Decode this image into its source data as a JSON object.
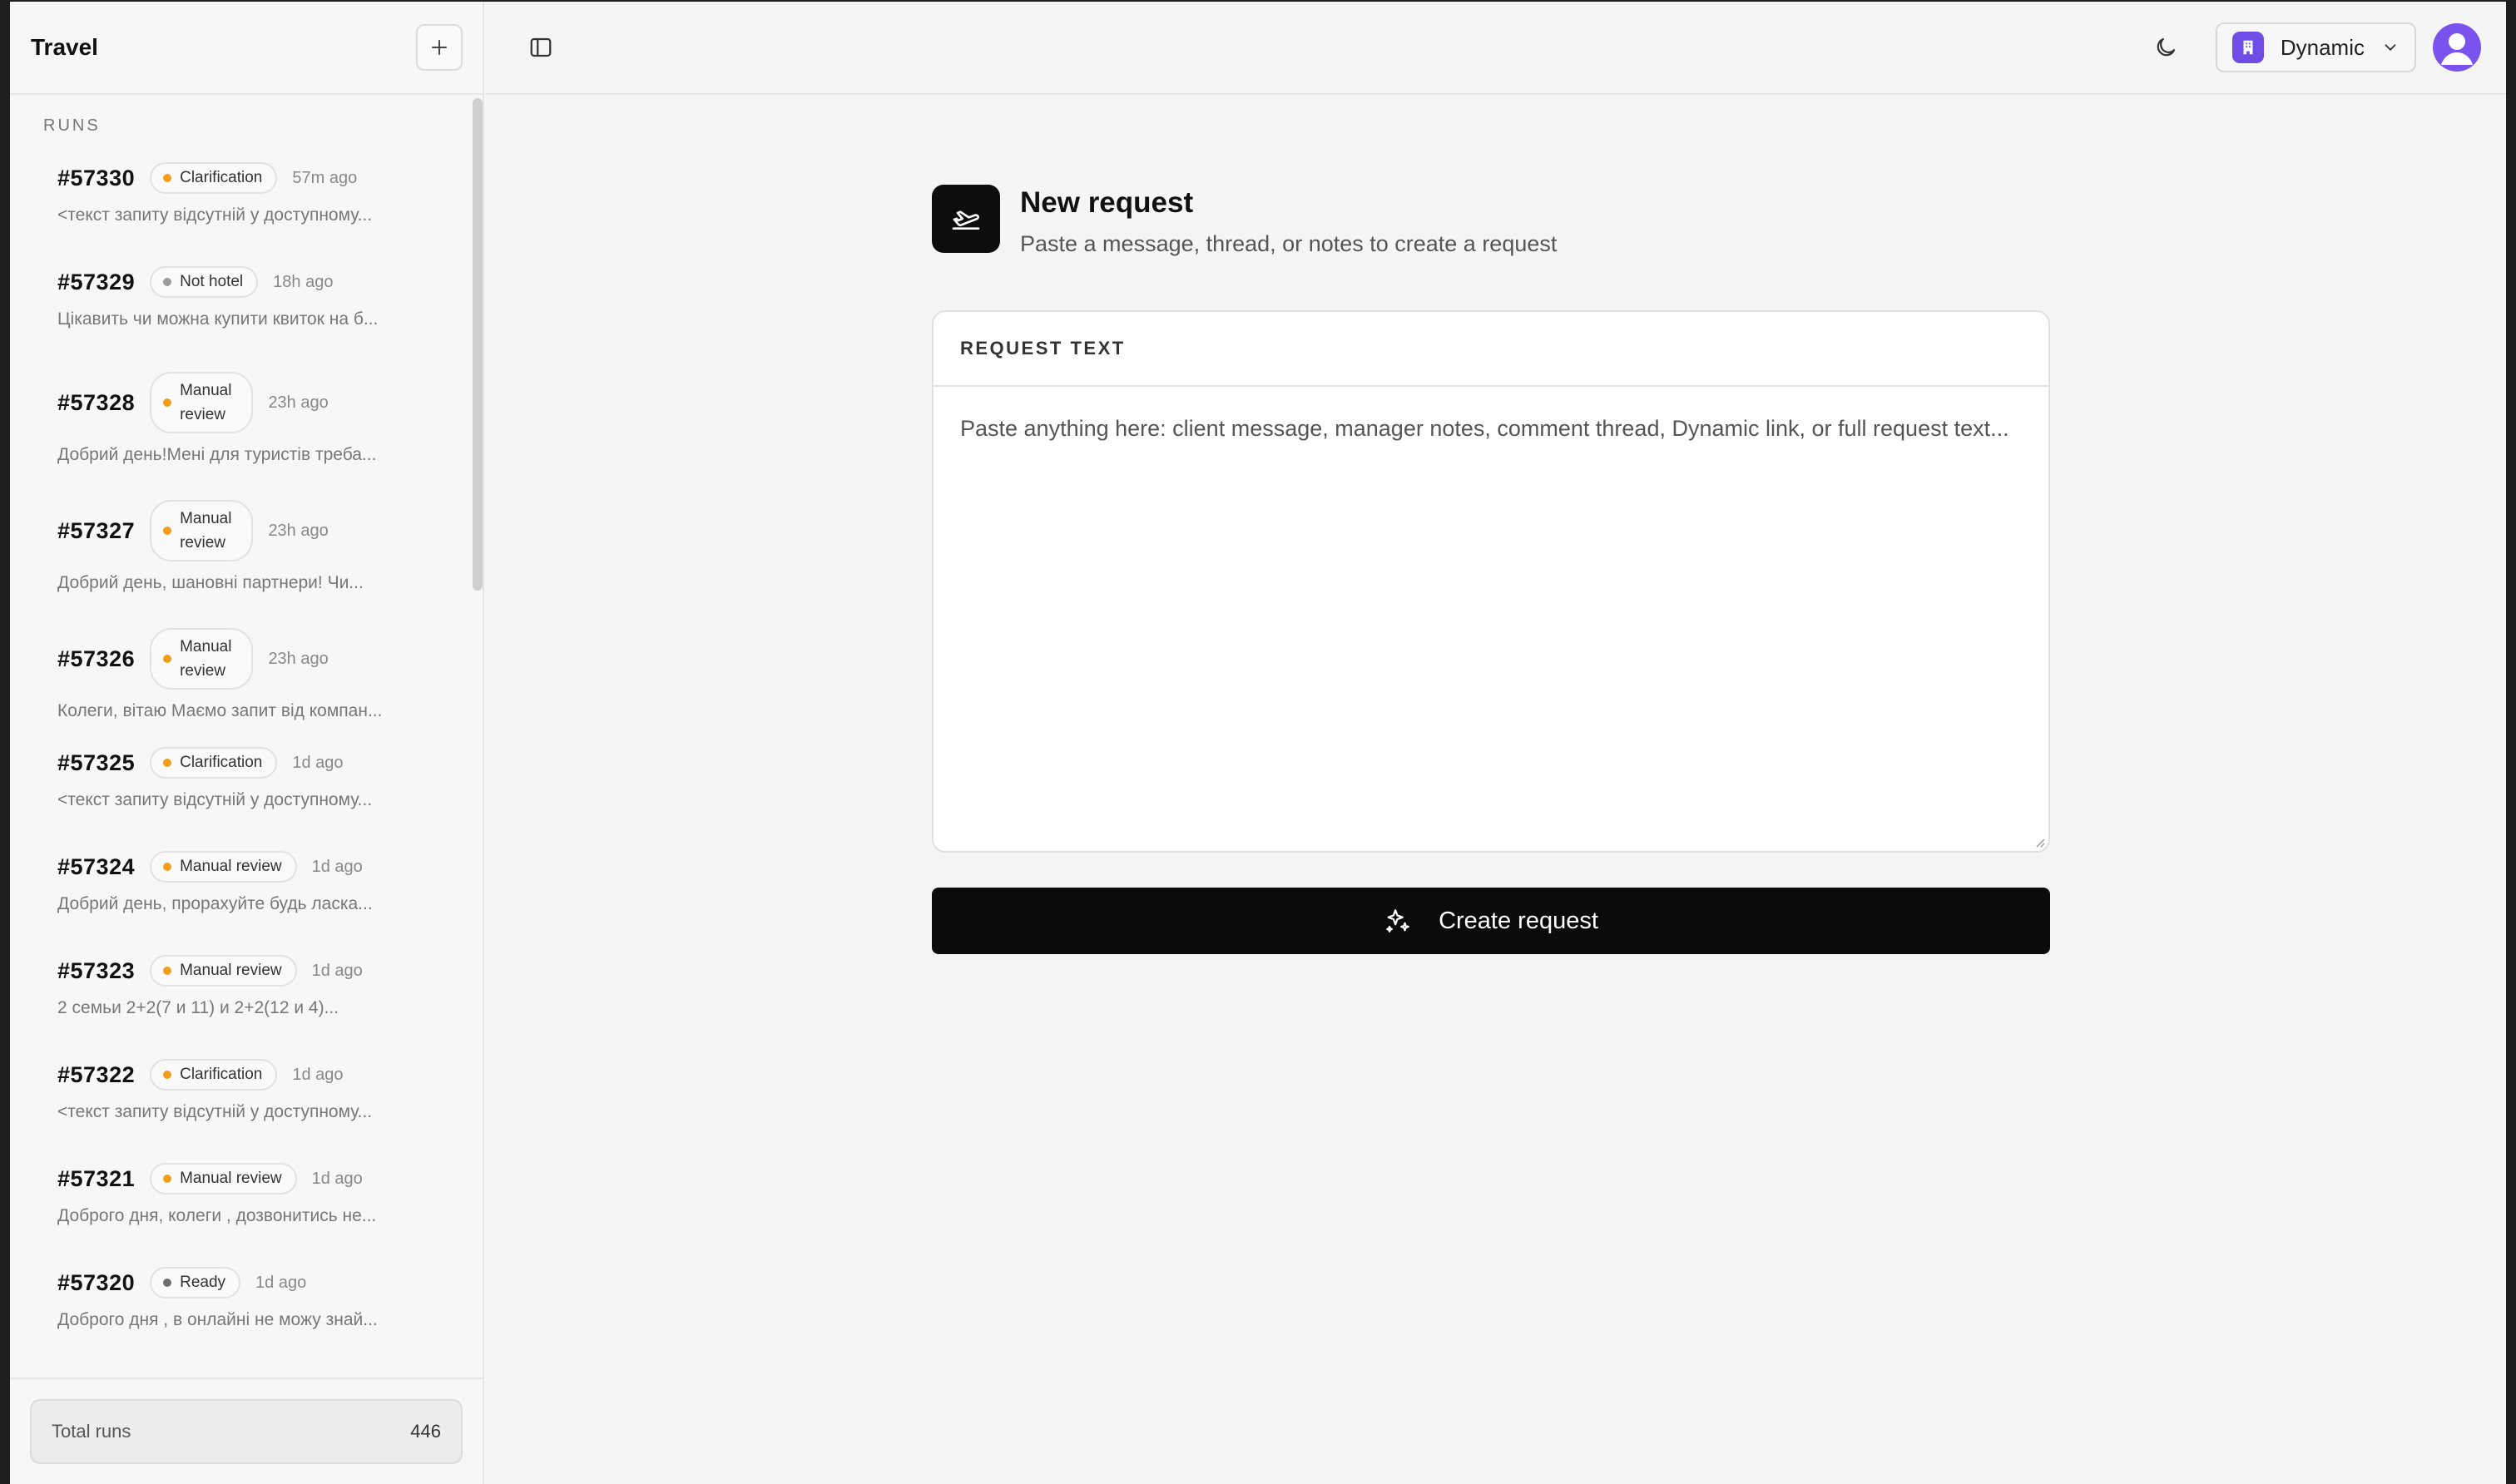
{
  "sidebar": {
    "title": "Travel",
    "section_label": "RUNS",
    "runs": [
      {
        "id": "#57330",
        "status": "Clarification",
        "status_color": "#f29d1c",
        "time": "57m ago",
        "preview": "<текст запиту відсутній у доступному..."
      },
      {
        "id": "#57329",
        "status": "Not hotel",
        "status_color": "#9a9a9a",
        "time": "18h ago",
        "preview": "Цікавить чи можна купити квиток на б..."
      },
      {
        "id": "#57328",
        "status_l1": "Manual",
        "status_l2": "review",
        "status_color": "#f29d1c",
        "time": "23h ago",
        "preview": "Добрий день!Мені для туристів треба..."
      },
      {
        "id": "#57327",
        "status_l1": "Manual",
        "status_l2": "review",
        "status_color": "#f29d1c",
        "time": "23h ago",
        "preview": "Добрий день, шановні партнери! Чи..."
      },
      {
        "id": "#57326",
        "status_l1": "Manual",
        "status_l2": "review",
        "status_color": "#f29d1c",
        "time": "23h ago",
        "preview": "Колеги, вітаю Маємо запит від компан..."
      },
      {
        "id": "#57325",
        "status": "Clarification",
        "status_color": "#f29d1c",
        "time": "1d ago",
        "preview": "<текст запиту відсутній у доступному..."
      },
      {
        "id": "#57324",
        "status": "Manual review",
        "status_color": "#f29d1c",
        "time": "1d ago",
        "preview": "Добрий день, прорахуйте будь ласка..."
      },
      {
        "id": "#57323",
        "status": "Manual review",
        "status_color": "#f29d1c",
        "time": "1d ago",
        "preview": "2 семьи 2+2(7 и 11) и 2+2(12 и 4)..."
      },
      {
        "id": "#57322",
        "status": "Clarification",
        "status_color": "#f29d1c",
        "time": "1d ago",
        "preview": "<текст запиту відсутній у доступному..."
      },
      {
        "id": "#57321",
        "status": "Manual review",
        "status_color": "#f29d1c",
        "time": "1d ago",
        "preview": "Доброго дня, колеги , дозвонитись не..."
      },
      {
        "id": "#57320",
        "status": "Ready",
        "status_color": "#6e6e6e",
        "time": "1d ago",
        "preview": "Доброго дня , в онлайні не можу знай..."
      }
    ],
    "footer": {
      "label": "Total runs",
      "value": "446"
    }
  },
  "topbar": {
    "workspace": "Dynamic",
    "accent": "#6d4de6"
  },
  "main": {
    "title": "New request",
    "subtitle": "Paste a message, thread, or notes to create a request",
    "card_label": "REQUEST TEXT",
    "placeholder": "Paste anything here: client message, manager notes, comment thread, Dynamic link, or full request text...",
    "button_label": "Create request"
  }
}
